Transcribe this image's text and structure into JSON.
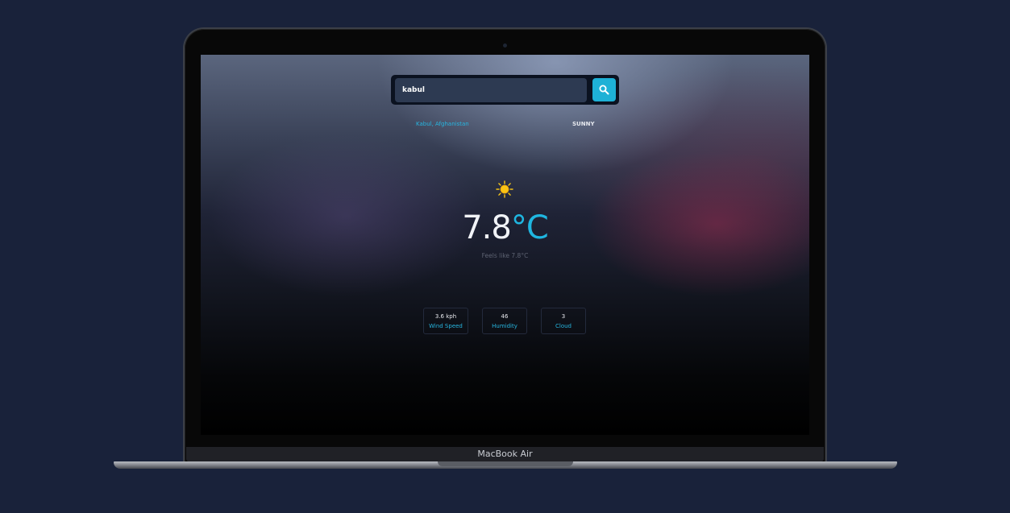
{
  "device": {
    "label": "MacBook Air"
  },
  "search": {
    "value": "kabul"
  },
  "weather": {
    "location": "Kabul, Afghanistan",
    "condition": "SUNNY",
    "temperature": "7.8",
    "unit": "°C",
    "feels_like": "Feels like 7.8°C",
    "icon": "sun-icon"
  },
  "stats": [
    {
      "value": "3.6 kph",
      "label": "Wind Speed"
    },
    {
      "value": "46",
      "label": "Humidity"
    },
    {
      "value": "3",
      "label": "Cloud"
    }
  ],
  "colors": {
    "accent": "#1eb1d6",
    "background": "#19223a",
    "sun": "#f5c518"
  }
}
